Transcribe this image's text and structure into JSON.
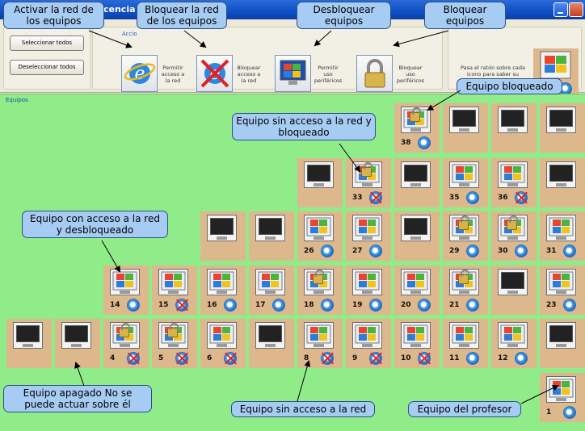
{
  "window": {
    "title_fragment": "cencia -"
  },
  "toolbar": {
    "group_label": "Accio",
    "select_all": "Seleccionar todos",
    "deselect_all": "Deseleccionar todos",
    "actions": [
      {
        "text": "Permitir acceso a la red"
      },
      {
        "text": "Bloquear acceso a la red"
      },
      {
        "text": "Permitir uso periféricos"
      },
      {
        "text": "Bloquear uso periféricos"
      }
    ],
    "hint": "Pasa el ratón sobre cada icono para saber su significado",
    "legend_letter": "N"
  },
  "area": {
    "label": "Equipos"
  },
  "computers": [
    {
      "num": "38",
      "state": "locked",
      "net": "on"
    },
    {
      "num": "",
      "state": "off",
      "net": ""
    },
    {
      "num": "",
      "state": "off",
      "net": ""
    },
    {
      "num": "",
      "state": "off",
      "net": ""
    },
    {
      "num": "",
      "state": "off",
      "net": ""
    },
    {
      "num": "33",
      "state": "locked",
      "net": "off"
    },
    {
      "num": "",
      "state": "off",
      "net": ""
    },
    {
      "num": "35",
      "state": "win",
      "net": "on"
    },
    {
      "num": "36",
      "state": "win",
      "net": "off"
    },
    {
      "num": "",
      "state": "off",
      "net": ""
    },
    {
      "num": "",
      "state": "off",
      "net": ""
    },
    {
      "num": "",
      "state": "off",
      "net": ""
    },
    {
      "num": "26",
      "state": "win",
      "net": "on"
    },
    {
      "num": "27",
      "state": "win",
      "net": "on"
    },
    {
      "num": "",
      "state": "off",
      "net": ""
    },
    {
      "num": "29",
      "state": "locked",
      "net": "on"
    },
    {
      "num": "30",
      "state": "locked",
      "net": "on"
    },
    {
      "num": "31",
      "state": "win",
      "net": "on"
    },
    {
      "num": "14",
      "state": "win",
      "net": "on"
    },
    {
      "num": "15",
      "state": "win",
      "net": "off"
    },
    {
      "num": "16",
      "state": "win",
      "net": "on"
    },
    {
      "num": "17",
      "state": "win",
      "net": "on"
    },
    {
      "num": "18",
      "state": "locked",
      "net": "on"
    },
    {
      "num": "19",
      "state": "win",
      "net": "on"
    },
    {
      "num": "20",
      "state": "win",
      "net": "on"
    },
    {
      "num": "21",
      "state": "locked",
      "net": "on"
    },
    {
      "num": "",
      "state": "off",
      "net": ""
    },
    {
      "num": "23",
      "state": "win",
      "net": "on"
    },
    {
      "num": "",
      "state": "off",
      "net": ""
    },
    {
      "num": "",
      "state": "off",
      "net": ""
    },
    {
      "num": "4",
      "state": "locked",
      "net": "off"
    },
    {
      "num": "5",
      "state": "locked",
      "net": "off"
    },
    {
      "num": "6",
      "state": "win",
      "net": "off"
    },
    {
      "num": "",
      "state": "off",
      "net": ""
    },
    {
      "num": "8",
      "state": "win",
      "net": "off"
    },
    {
      "num": "9",
      "state": "win",
      "net": "off"
    },
    {
      "num": "10",
      "state": "win",
      "net": "off"
    },
    {
      "num": "11",
      "state": "win",
      "net": "on"
    },
    {
      "num": "12",
      "state": "win",
      "net": "on"
    },
    {
      "num": "",
      "state": "off",
      "net": ""
    },
    {
      "num": "1",
      "state": "win",
      "net": "on"
    }
  ],
  "callouts": {
    "activar": "Activar la red de los equipos",
    "bloquear_red": "Bloquear la red de los equipos",
    "desbloquear": "Desbloquear equipos",
    "bloquear_eq": "Bloquear equipos",
    "bloqueado": "Equipo bloqueado",
    "sin_acceso_bloq": "Equipo sin acceso a la red y bloqueado",
    "con_acceso": "Equipo con acceso a la red y desbloqueado",
    "apagado": "Equipo apagado No se puede actuar sobre él",
    "sin_acceso": "Equipo sin acceso a la red",
    "profesor": "Equipo del profesor"
  },
  "colors": {
    "area_bg": "#90ec88",
    "cell_bg": "#dcb88c",
    "callout_bg": "#a7ccf4"
  }
}
